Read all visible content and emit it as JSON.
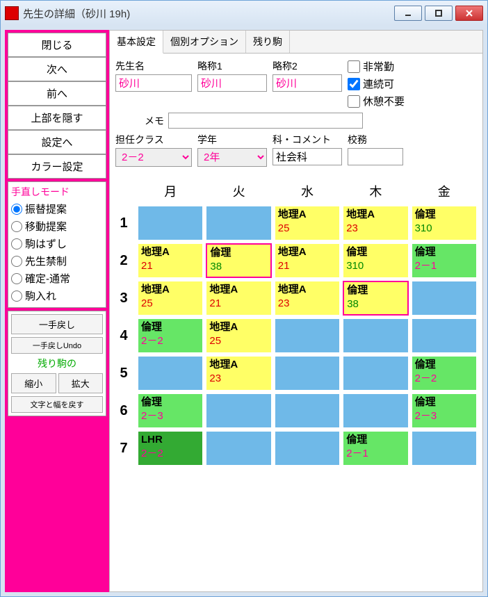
{
  "window": {
    "title": "先生の詳細（砂川 19h)"
  },
  "sidebar": {
    "buttons": [
      "閉じる",
      "次へ",
      "前へ",
      "上部を隠す",
      "設定へ",
      "カラー設定"
    ],
    "mode_header": "手直しモード",
    "modes": [
      "振替提案",
      "移動提案",
      "駒はずし",
      "先生禁制",
      "確定-通常",
      "駒入れ"
    ],
    "mode_selected": 0,
    "undo1": "一手戻し",
    "undo2": "一手戻しUndo",
    "remain_label": "残り駒の",
    "shrink": "縮小",
    "enlarge": "拡大",
    "reset_width": "文字と幅を戻す"
  },
  "tabs": [
    "基本設定",
    "個別オプション",
    "残り駒"
  ],
  "tab_active": 0,
  "form": {
    "name_label": "先生名",
    "name_value": "砂川",
    "abbr1_label": "略称1",
    "abbr1_value": "砂川",
    "abbr2_label": "略称2",
    "abbr2_value": "砂川",
    "memo_label": "メモ",
    "memo_value": "",
    "class_label": "担任クラス",
    "class_value": "2－2",
    "grade_label": "学年",
    "grade_value": "2年",
    "subj_label": "科・コメント",
    "subj_value": "社会科",
    "duty_label": "校務",
    "duty_value": "",
    "chk_parttime": "非常勤",
    "chk_parttime_v": false,
    "chk_consec": "連続可",
    "chk_consec_v": true,
    "chk_nobreak": "休憩不要",
    "chk_nobreak_v": false
  },
  "days": [
    "月",
    "火",
    "水",
    "木",
    "金"
  ],
  "periods": [
    "1",
    "2",
    "3",
    "4",
    "5",
    "6",
    "7"
  ],
  "grid": [
    [
      null,
      null,
      {
        "s": "地理A",
        "n": "25",
        "c": "yellow",
        "nc": "red"
      },
      {
        "s": "地理A",
        "n": "23",
        "c": "yellow",
        "nc": "red"
      },
      {
        "s": "倫理",
        "n": "310",
        "c": "yellow",
        "nc": "grn"
      }
    ],
    [
      {
        "s": "地理A",
        "n": "21",
        "c": "yellow",
        "nc": "red"
      },
      {
        "s": "倫理",
        "n": "38",
        "c": "yellow",
        "nc": "grn",
        "pb": true
      },
      {
        "s": "地理A",
        "n": "21",
        "c": "yellow",
        "nc": "red"
      },
      {
        "s": "倫理",
        "n": "310",
        "c": "yellow",
        "nc": "grn"
      },
      {
        "s": "倫理",
        "n": "2－1",
        "c": "green",
        "nc": "mag"
      }
    ],
    [
      {
        "s": "地理A",
        "n": "25",
        "c": "yellow",
        "nc": "red"
      },
      {
        "s": "地理A",
        "n": "21",
        "c": "yellow",
        "nc": "red"
      },
      {
        "s": "地理A",
        "n": "23",
        "c": "yellow",
        "nc": "red"
      },
      {
        "s": "倫理",
        "n": "38",
        "c": "yellow",
        "nc": "grn",
        "pb": true
      },
      null
    ],
    [
      {
        "s": "倫理",
        "n": "2－2",
        "c": "green",
        "nc": "mag"
      },
      {
        "s": "地理A",
        "n": "25",
        "c": "yellow",
        "nc": "red"
      },
      null,
      null,
      null
    ],
    [
      null,
      {
        "s": "地理A",
        "n": "23",
        "c": "yellow",
        "nc": "red"
      },
      null,
      null,
      {
        "s": "倫理",
        "n": "2－2",
        "c": "green",
        "nc": "mag"
      }
    ],
    [
      {
        "s": "倫理",
        "n": "2－3",
        "c": "green",
        "nc": "mag"
      },
      null,
      null,
      null,
      {
        "s": "倫理",
        "n": "2－3",
        "c": "green",
        "nc": "mag"
      }
    ],
    [
      {
        "s": "LHR",
        "n": "2－2",
        "c": "dgreen",
        "nc": "mag"
      },
      null,
      null,
      {
        "s": "倫理",
        "n": "2－1",
        "c": "green",
        "nc": "mag"
      },
      null
    ]
  ]
}
